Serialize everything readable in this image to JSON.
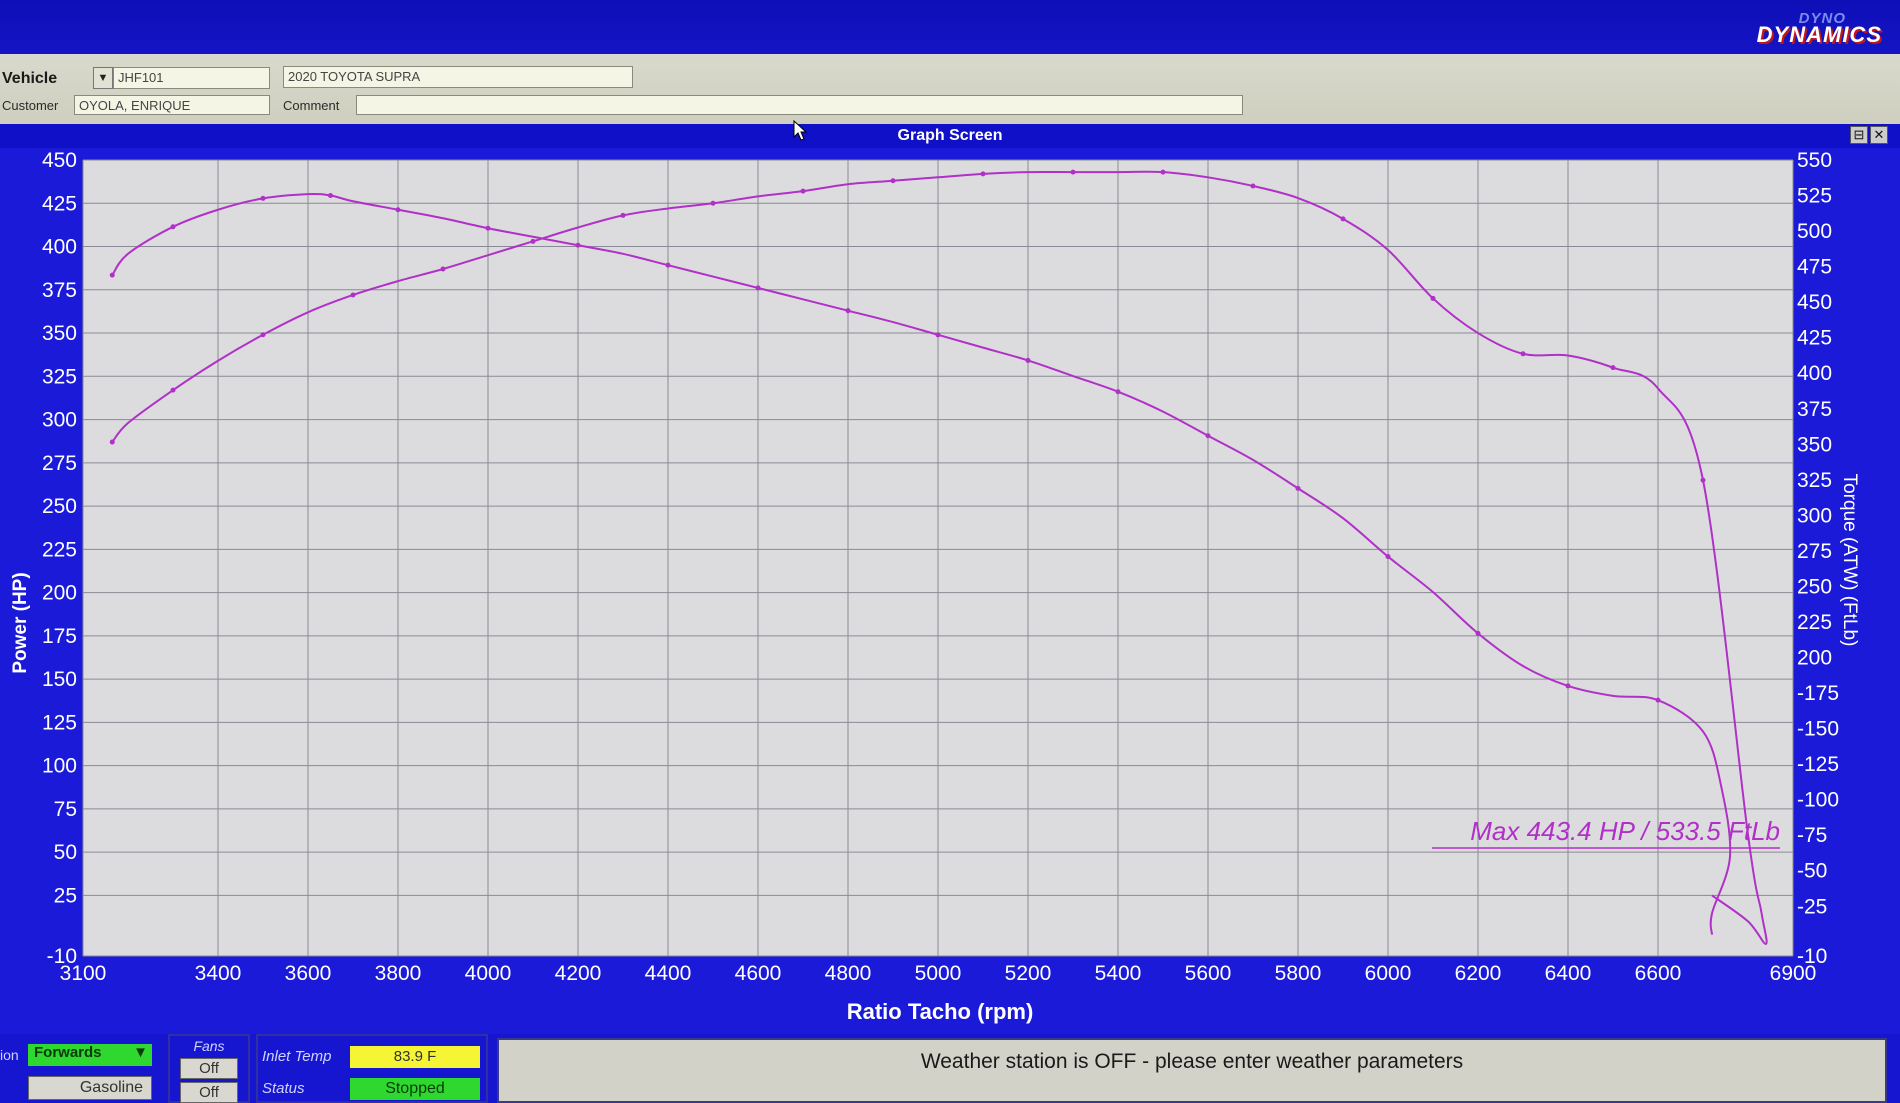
{
  "logo": {
    "line1": "DYNO",
    "line2": "DYNAMICS"
  },
  "vehicle": {
    "vehicle_label": "Vehicle",
    "vehicle_id": "JHF101",
    "vehicle_name": "2020 TOYOTA SUPRA",
    "customer_label": "Customer",
    "customer": "OYOLA, ENRIQUE",
    "comment_label": "Comment",
    "comment": ""
  },
  "graph_window": {
    "title": "Graph Screen",
    "btn_restore": "⊟",
    "btn_close": "✕"
  },
  "annotation": "Max 443.4 HP  / 533.5 FtLb",
  "status": {
    "direction_label": "ion",
    "direction_value": "Forwards",
    "fuel": "Gasoline",
    "fans_label": "Fans",
    "fan1": "Off",
    "fan2": "Off",
    "inlet_temp_label": "Inlet Temp",
    "inlet_temp": "83.9 F",
    "status_label": "Status",
    "status_value": "Stopped",
    "message": "Weather station is OFF - please enter weather parameters"
  },
  "colors": {
    "curve": "#b030c8",
    "plot_bg": "#dcdcde",
    "frame": "#1a1ad8"
  },
  "chart_data": {
    "type": "line",
    "xlabel": "Ratio Tacho (rpm)",
    "ylabel": "Power (HP)",
    "y2label": "Torque (ATW) (FtLb)",
    "xlim": [
      3100,
      6900
    ],
    "ylim": [
      -10,
      450
    ],
    "y2lim": [
      -10,
      550
    ],
    "x_ticks": [
      3100,
      3400,
      3600,
      3800,
      4000,
      4200,
      4400,
      4600,
      4800,
      5000,
      5200,
      5400,
      5600,
      5800,
      6000,
      6200,
      6400,
      6600,
      6900
    ],
    "y_ticks": [
      450,
      425,
      400,
      375,
      350,
      325,
      300,
      275,
      250,
      225,
      200,
      175,
      150,
      125,
      100,
      75,
      50,
      25,
      -10
    ],
    "y2_ticks": [
      550,
      525,
      500,
      475,
      450,
      425,
      400,
      375,
      350,
      325,
      300,
      275,
      250,
      225,
      200,
      175,
      150,
      125,
      100,
      75,
      50,
      25,
      -10
    ],
    "y_tick_labels": [
      "450",
      "425",
      "400",
      "375",
      "350",
      "325",
      "300",
      "275",
      "250",
      "225",
      "200",
      "175",
      "150",
      "125",
      "100",
      "75",
      "50",
      "25",
      "-10"
    ],
    "y2_tick_labels": [
      "550",
      "525",
      "500",
      "475",
      "450",
      "425",
      "400",
      "375",
      "350",
      "325",
      "300",
      "275",
      "250",
      "225",
      "200",
      "-175",
      "-150",
      "-125",
      "-100",
      "-75",
      "-50",
      "-25",
      "-10"
    ],
    "grid": true,
    "series": [
      {
        "axis": "left",
        "x": [
          3165,
          3200,
          3300,
          3400,
          3500,
          3600,
          3700,
          3800,
          3900,
          4000,
          4100,
          4200,
          4300,
          4400,
          4500,
          4600,
          4700,
          4800,
          4900,
          5000,
          5100,
          5200,
          5300,
          5400,
          5500,
          5600,
          5700,
          5800,
          5900,
          6000,
          6100,
          6200,
          6300,
          6400,
          6500,
          6600,
          6700,
          6800,
          6830,
          6840,
          6800,
          6720
        ],
        "y": [
          287,
          298,
          317,
          334,
          349,
          362,
          372,
          380,
          387,
          395,
          403,
          411,
          418,
          422,
          425,
          429,
          432,
          436,
          438,
          440,
          442,
          443,
          443,
          443,
          443,
          440,
          435,
          428,
          416,
          398,
          370,
          350,
          338,
          337,
          330,
          318,
          265,
          60,
          15,
          -3,
          10,
          25
        ]
      },
      {
        "axis": "right",
        "x": [
          3165,
          3200,
          3300,
          3400,
          3500,
          3600,
          3650,
          3700,
          3800,
          3900,
          4000,
          4100,
          4200,
          4300,
          4400,
          4500,
          4600,
          4700,
          4800,
          4900,
          5000,
          5100,
          5200,
          5300,
          5400,
          5500,
          5600,
          5700,
          5800,
          5900,
          6000,
          6100,
          6200,
          6300,
          6400,
          6500,
          6600,
          6700,
          6740,
          6760,
          6720,
          6720
        ],
        "y": [
          469,
          484,
          503,
          515,
          523,
          526,
          525,
          521,
          515,
          509,
          502,
          496,
          490,
          484,
          476,
          468,
          460,
          452,
          444,
          436,
          427,
          418,
          409,
          398,
          387,
          373,
          356,
          339,
          319,
          298,
          271,
          246,
          217,
          194,
          180,
          173,
          170,
          148,
          110,
          60,
          20,
          5
        ]
      }
    ]
  }
}
